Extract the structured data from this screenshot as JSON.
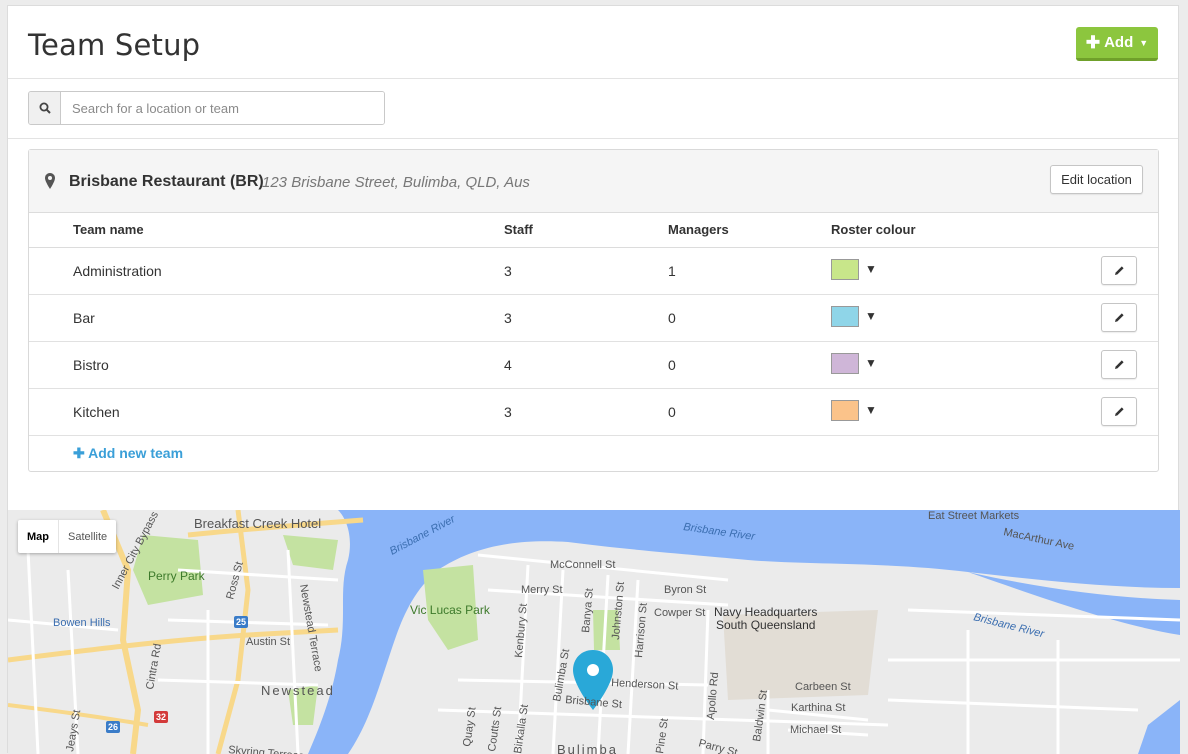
{
  "header": {
    "title": "Team Setup",
    "add_label": "Add"
  },
  "search": {
    "placeholder": "Search for a location or team"
  },
  "location": {
    "name": "Brisbane Restaurant (BR)",
    "address": "123 Brisbane Street, Bulimba, QLD, Aus",
    "edit_label": "Edit location"
  },
  "table": {
    "headers": {
      "name": "Team name",
      "staff": "Staff",
      "managers": "Managers",
      "colour": "Roster colour"
    },
    "rows": [
      {
        "name": "Administration",
        "staff": "3",
        "managers": "1",
        "colour": "#c8e68a"
      },
      {
        "name": "Bar",
        "staff": "3",
        "managers": "0",
        "colour": "#8fd5e8"
      },
      {
        "name": "Bistro",
        "staff": "4",
        "managers": "0",
        "colour": "#cfb6d8"
      },
      {
        "name": "Kitchen",
        "staff": "3",
        "managers": "0",
        "colour": "#fbc38a"
      }
    ],
    "add_team_label": "Add new team"
  },
  "map": {
    "type_map": "Map",
    "type_satellite": "Satellite",
    "labels": {
      "breakfast_creek": "Breakfast Creek Hotel",
      "brisbane_river_1": "Brisbane River",
      "brisbane_river_2": "Brisbane River",
      "brisbane_river_3": "Brisbane River",
      "eat_street": "Eat Street Markets",
      "macarthur": "MacArthur Ave",
      "inner_city": "Inner City Bypass",
      "perry_park": "Perry Park",
      "ross_st": "Ross St",
      "bowen_hills": "Bowen Hills",
      "newstead_terrace": "Newstead Terrace",
      "austin_st": "Austin St",
      "cintra_rd": "Cintra Rd",
      "newstead": "Newstead",
      "jeays_st": "Jeays St",
      "skyring": "Skyring Terrace",
      "vic_lucas": "Vic Lucas Park",
      "mcconnell": "McConnell St",
      "merry_st": "Merry St",
      "byron_st": "Byron St",
      "cowper_st": "Cowper St",
      "navy_hq_1": "Navy Headquarters",
      "navy_hq_2": "South Queensland",
      "kenbury": "Kenbury St",
      "banya": "Banya St",
      "johnston": "Johnston St",
      "harrison": "Harrison St",
      "henderson": "Henderson St",
      "apollo": "Apollo Rd",
      "bulimba_st": "Bulimba St",
      "brisbane_st": "Brisbane St",
      "carbeen": "Carbeen St",
      "karthina": "Karthina St",
      "michael": "Michael St",
      "baldwin": "Baldwin St",
      "quay_st": "Quay St",
      "coutts": "Coutts St",
      "birkalla": "Birkalla St",
      "bulimba": "Bulimba",
      "pine_st": "Pine St",
      "parry": "Parry St",
      "route_25": "25",
      "route_26": "26",
      "route_32": "32"
    }
  }
}
